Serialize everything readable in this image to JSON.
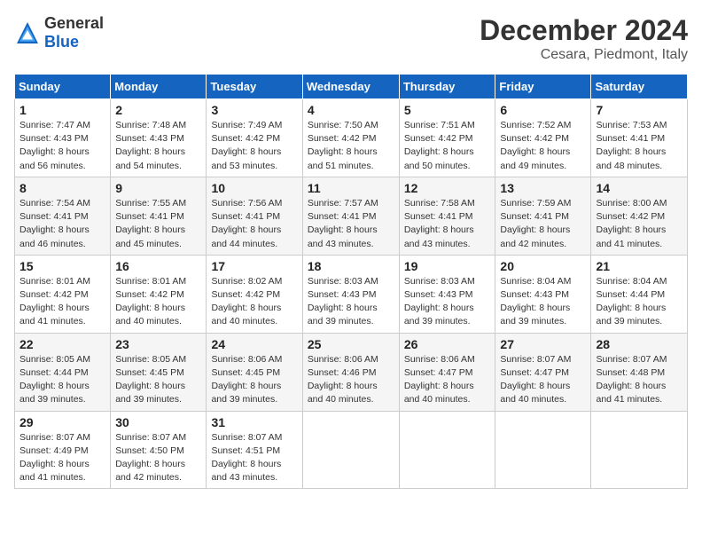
{
  "header": {
    "logo_general": "General",
    "logo_blue": "Blue",
    "title": "December 2024",
    "subtitle": "Cesara, Piedmont, Italy"
  },
  "days_of_week": [
    "Sunday",
    "Monday",
    "Tuesday",
    "Wednesday",
    "Thursday",
    "Friday",
    "Saturday"
  ],
  "weeks": [
    [
      {
        "day": "1",
        "sunrise": "7:47 AM",
        "sunset": "4:43 PM",
        "daylight": "8 hours and 56 minutes."
      },
      {
        "day": "2",
        "sunrise": "7:48 AM",
        "sunset": "4:43 PM",
        "daylight": "8 hours and 54 minutes."
      },
      {
        "day": "3",
        "sunrise": "7:49 AM",
        "sunset": "4:42 PM",
        "daylight": "8 hours and 53 minutes."
      },
      {
        "day": "4",
        "sunrise": "7:50 AM",
        "sunset": "4:42 PM",
        "daylight": "8 hours and 51 minutes."
      },
      {
        "day": "5",
        "sunrise": "7:51 AM",
        "sunset": "4:42 PM",
        "daylight": "8 hours and 50 minutes."
      },
      {
        "day": "6",
        "sunrise": "7:52 AM",
        "sunset": "4:42 PM",
        "daylight": "8 hours and 49 minutes."
      },
      {
        "day": "7",
        "sunrise": "7:53 AM",
        "sunset": "4:41 PM",
        "daylight": "8 hours and 48 minutes."
      }
    ],
    [
      {
        "day": "8",
        "sunrise": "7:54 AM",
        "sunset": "4:41 PM",
        "daylight": "8 hours and 46 minutes."
      },
      {
        "day": "9",
        "sunrise": "7:55 AM",
        "sunset": "4:41 PM",
        "daylight": "8 hours and 45 minutes."
      },
      {
        "day": "10",
        "sunrise": "7:56 AM",
        "sunset": "4:41 PM",
        "daylight": "8 hours and 44 minutes."
      },
      {
        "day": "11",
        "sunrise": "7:57 AM",
        "sunset": "4:41 PM",
        "daylight": "8 hours and 43 minutes."
      },
      {
        "day": "12",
        "sunrise": "7:58 AM",
        "sunset": "4:41 PM",
        "daylight": "8 hours and 43 minutes."
      },
      {
        "day": "13",
        "sunrise": "7:59 AM",
        "sunset": "4:41 PM",
        "daylight": "8 hours and 42 minutes."
      },
      {
        "day": "14",
        "sunrise": "8:00 AM",
        "sunset": "4:42 PM",
        "daylight": "8 hours and 41 minutes."
      }
    ],
    [
      {
        "day": "15",
        "sunrise": "8:01 AM",
        "sunset": "4:42 PM",
        "daylight": "8 hours and 41 minutes."
      },
      {
        "day": "16",
        "sunrise": "8:01 AM",
        "sunset": "4:42 PM",
        "daylight": "8 hours and 40 minutes."
      },
      {
        "day": "17",
        "sunrise": "8:02 AM",
        "sunset": "4:42 PM",
        "daylight": "8 hours and 40 minutes."
      },
      {
        "day": "18",
        "sunrise": "8:03 AM",
        "sunset": "4:43 PM",
        "daylight": "8 hours and 39 minutes."
      },
      {
        "day": "19",
        "sunrise": "8:03 AM",
        "sunset": "4:43 PM",
        "daylight": "8 hours and 39 minutes."
      },
      {
        "day": "20",
        "sunrise": "8:04 AM",
        "sunset": "4:43 PM",
        "daylight": "8 hours and 39 minutes."
      },
      {
        "day": "21",
        "sunrise": "8:04 AM",
        "sunset": "4:44 PM",
        "daylight": "8 hours and 39 minutes."
      }
    ],
    [
      {
        "day": "22",
        "sunrise": "8:05 AM",
        "sunset": "4:44 PM",
        "daylight": "8 hours and 39 minutes."
      },
      {
        "day": "23",
        "sunrise": "8:05 AM",
        "sunset": "4:45 PM",
        "daylight": "8 hours and 39 minutes."
      },
      {
        "day": "24",
        "sunrise": "8:06 AM",
        "sunset": "4:45 PM",
        "daylight": "8 hours and 39 minutes."
      },
      {
        "day": "25",
        "sunrise": "8:06 AM",
        "sunset": "4:46 PM",
        "daylight": "8 hours and 40 minutes."
      },
      {
        "day": "26",
        "sunrise": "8:06 AM",
        "sunset": "4:47 PM",
        "daylight": "8 hours and 40 minutes."
      },
      {
        "day": "27",
        "sunrise": "8:07 AM",
        "sunset": "4:47 PM",
        "daylight": "8 hours and 40 minutes."
      },
      {
        "day": "28",
        "sunrise": "8:07 AM",
        "sunset": "4:48 PM",
        "daylight": "8 hours and 41 minutes."
      }
    ],
    [
      {
        "day": "29",
        "sunrise": "8:07 AM",
        "sunset": "4:49 PM",
        "daylight": "8 hours and 41 minutes."
      },
      {
        "day": "30",
        "sunrise": "8:07 AM",
        "sunset": "4:50 PM",
        "daylight": "8 hours and 42 minutes."
      },
      {
        "day": "31",
        "sunrise": "8:07 AM",
        "sunset": "4:51 PM",
        "daylight": "8 hours and 43 minutes."
      },
      null,
      null,
      null,
      null
    ]
  ]
}
